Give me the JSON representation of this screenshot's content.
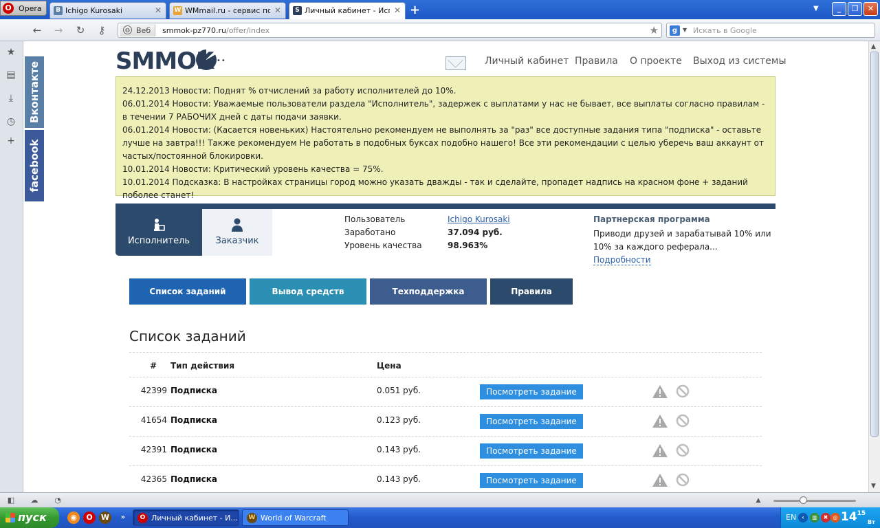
{
  "browser": {
    "opera_label": "Opera",
    "tabs": [
      {
        "title": "Ichigo Kurosaki",
        "fav": "В"
      },
      {
        "title": "WMmail.ru - сервис поч…",
        "fav": "W"
      },
      {
        "title": "Личный кабинет - Испо…",
        "fav": "S"
      }
    ],
    "address": {
      "badge": "Веб",
      "host": "smmok-pz770.ru",
      "path": "/offer/index"
    },
    "search_placeholder": "Искать в Google"
  },
  "social": {
    "vk": "Вконтакте",
    "fb": "facebook"
  },
  "site": {
    "logo": "SMMOK",
    "nav": [
      "Личный кабинет",
      "Правила",
      "О проекте",
      "Выход из системы"
    ]
  },
  "news": [
    "24.12.2013 Новости: Поднят % отчислений за работу исполнителей до 10%.",
    "06.01.2014 Новости: Уважаемые пользователи раздела \"Исполнитель\", задержек с выплатами у нас не бывает, все выплаты согласно правилам - в течении 7 РАБОЧИХ дней с даты подачи заявки.",
    "06.01.2014 Новости: (Касается новеньких) Настоятельно рекомендуем не выполнять за \"раз\" все доступные задания типа \"подписка\" - оставьте лучше на завтра!!! Также рекомендуем Не работать в подобных буксах подобно нашего! Все эти рекомендации с целью уберечь ваш аккаунт от частых/постоянной блокировки.",
    "10.01.2014 Новости: Критический уровень качества = 75%.",
    "10.01.2014 Подсказка: В настройках страницы город можно указать дважды - так и сделайте, пропадет надпись на красном фоне + заданий поболее станет!"
  ],
  "roles": {
    "executor": "Исполнитель",
    "customer": "Заказчик"
  },
  "user": {
    "user_label": "Пользователь",
    "user_value": "Ichigo Kurosaki",
    "earned_label": "Заработано",
    "earned_value": "37.094 руб.",
    "quality_label": "Уровень качества",
    "quality_value": "98.963%"
  },
  "partner": {
    "title": "Партнерская программа",
    "text": "Приводи друзей и зарабатывай 10% или 10% за каждого реферала...",
    "more": "Подробности"
  },
  "actions": [
    {
      "label": "Список заданий",
      "color": "#1f64b0"
    },
    {
      "label": "Вывод средств",
      "color": "#2b8fb3"
    },
    {
      "label": "Техподдержка",
      "color": "#3e5d8f"
    },
    {
      "label": "Правила",
      "color": "#2c4a6b"
    }
  ],
  "tasks": {
    "title": "Список заданий",
    "headers": {
      "id": "#",
      "type": "Тип действия",
      "price": "Цена"
    },
    "button_label": "Посмотреть задание",
    "rows": [
      {
        "id": "42399",
        "type": "Подписка",
        "price": "0.051 руб."
      },
      {
        "id": "41654",
        "type": "Подписка",
        "price": "0.123 руб."
      },
      {
        "id": "42391",
        "type": "Подписка",
        "price": "0.143 руб."
      },
      {
        "id": "42365",
        "type": "Подписка",
        "price": "0.143 руб."
      }
    ]
  },
  "taskbar": {
    "start": "пуск",
    "tasks": [
      "Личный кабинет - И...",
      "World of Warcraft"
    ],
    "lang": "EN",
    "clock_hour": "14",
    "clock_min": "15",
    "clock_day": "Вт"
  }
}
